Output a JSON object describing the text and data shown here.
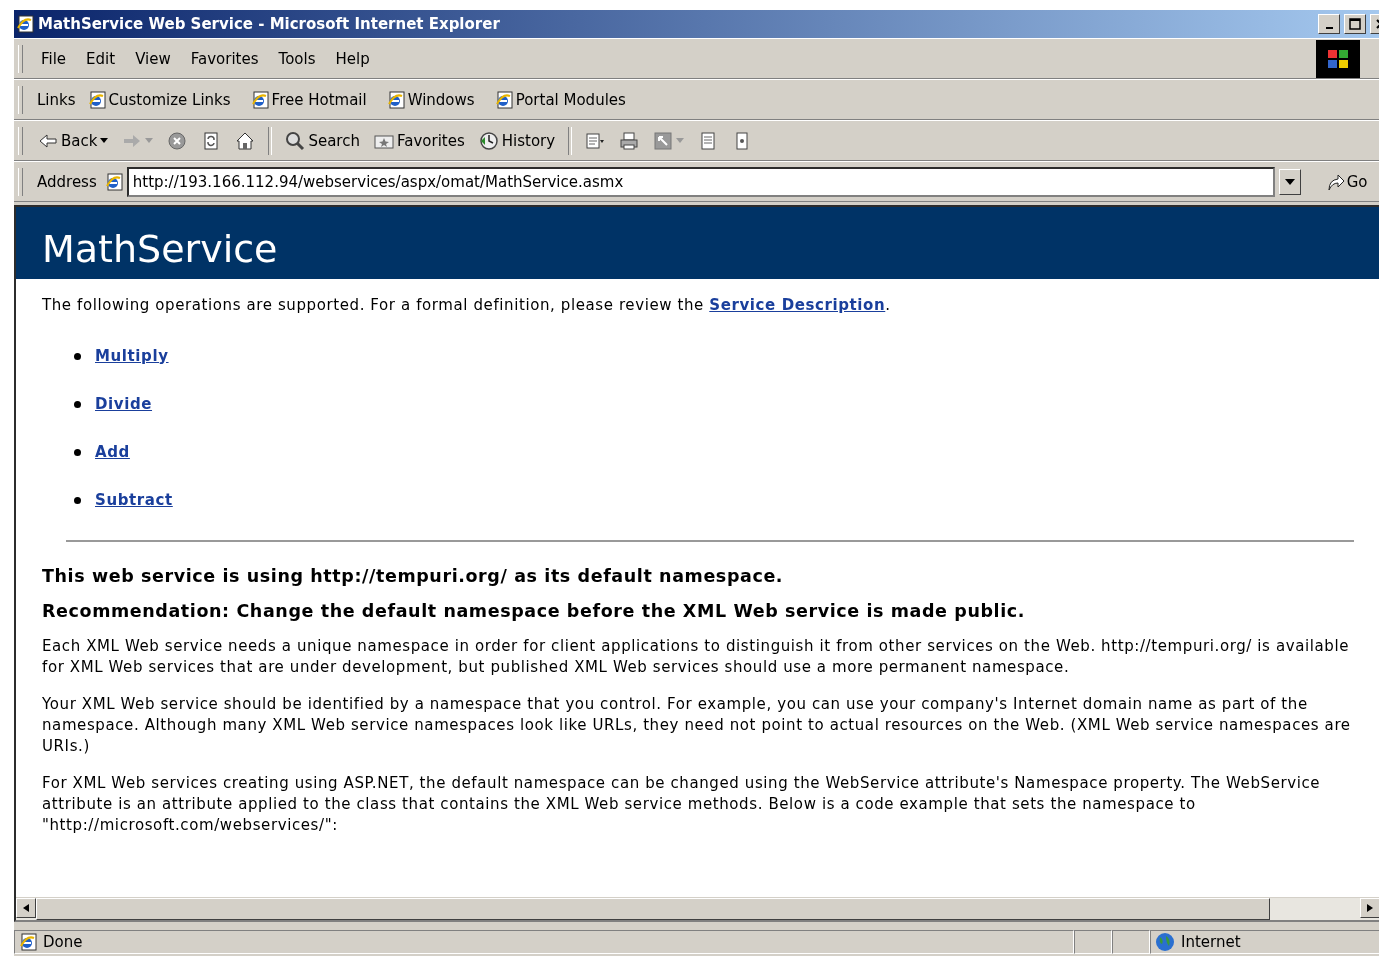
{
  "window": {
    "title": "MathService Web Service - Microsoft Internet Explorer"
  },
  "menu": [
    "File",
    "Edit",
    "View",
    "Favorites",
    "Tools",
    "Help"
  ],
  "links_bar": {
    "label": "Links",
    "items": [
      "Customize Links",
      "Free Hotmail",
      "Windows",
      "Portal Modules"
    ]
  },
  "toolbar": [
    {
      "kind": "back",
      "label": "Back"
    },
    {
      "kind": "forward"
    },
    {
      "kind": "stop"
    },
    {
      "kind": "refresh"
    },
    {
      "kind": "home"
    },
    {
      "kind": "search",
      "label": "Search"
    },
    {
      "kind": "favorites",
      "label": "Favorites"
    },
    {
      "kind": "history",
      "label": "History"
    },
    {
      "kind": "mail"
    },
    {
      "kind": "print"
    },
    {
      "kind": "edit"
    },
    {
      "kind": "discuss"
    },
    {
      "kind": "messenger"
    }
  ],
  "address_bar": {
    "label": "Address",
    "value": "http://193.166.112.94/webservices/aspx/omat/MathService.asmx",
    "go": "Go"
  },
  "page": {
    "heading": "MathService",
    "intro": "The following operations are supported. For a formal definition, please review the ",
    "intro_link": "Service Description",
    "intro_end": ".",
    "operations": [
      "Multiply",
      "Divide",
      "Add",
      "Subtract"
    ],
    "notice": [
      "This web service is using http://tempuri.org/ as its default namespace.",
      "Recommendation: Change the default namespace before the XML Web service is made public."
    ],
    "paragraphs": [
      "Each XML Web service needs a unique namespace in order for client applications to distinguish it from other services on the Web. http://tempuri.org/ is available for XML Web services that are under development, but published XML Web services should use a more permanent namespace.",
      "Your XML Web service should be identified by a namespace that you control. For example, you can use your company's Internet domain name as part of the namespace. Although many XML Web service namespaces look like URLs, they need not point to actual resources on the Web. (XML Web service namespaces are URIs.)",
      "For XML Web services creating using ASP.NET, the default namespace can be changed using the WebService attribute's Namespace property. The WebService attribute is an attribute applied to the class that contains the XML Web service methods. Below is a code example that sets the namespace to \"http://microsoft.com/webservices/\":"
    ]
  },
  "status_bar": {
    "text": "Done",
    "zone": "Internet"
  }
}
